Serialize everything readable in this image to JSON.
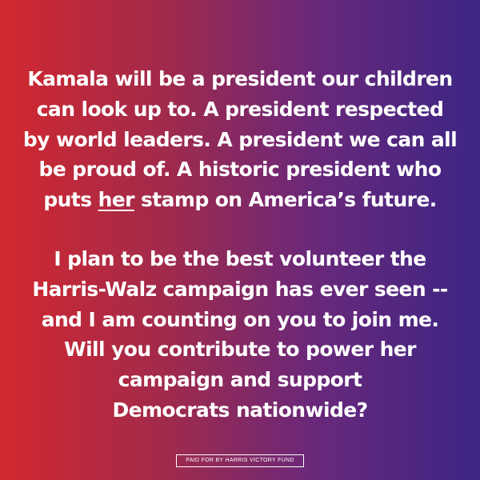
{
  "colors": {
    "gradient_left": "#d2282e",
    "gradient_right": "#3c2685",
    "text": "#ffffff"
  },
  "paragraph_1": {
    "line_1": "Kamala will be a president our children",
    "line_2": "can look up to. A president respected",
    "line_3": "by world leaders. A president we can all",
    "line_4": "be proud of. A historic president who",
    "line_5_pre": "puts ",
    "line_5_emphasis": "her",
    "line_5_post": " stamp on America’s future."
  },
  "paragraph_2": {
    "line_1": "I plan to be the best volunteer the",
    "line_2": "Harris-Walz campaign has ever seen --",
    "line_3": "and I am counting on you to join me.",
    "line_4": "Will you contribute to power her",
    "line_5": "campaign and support",
    "line_6": "Democrats nationwide?"
  },
  "disclaimer": "PAID FOR BY HARRIS VICTORY FUND"
}
